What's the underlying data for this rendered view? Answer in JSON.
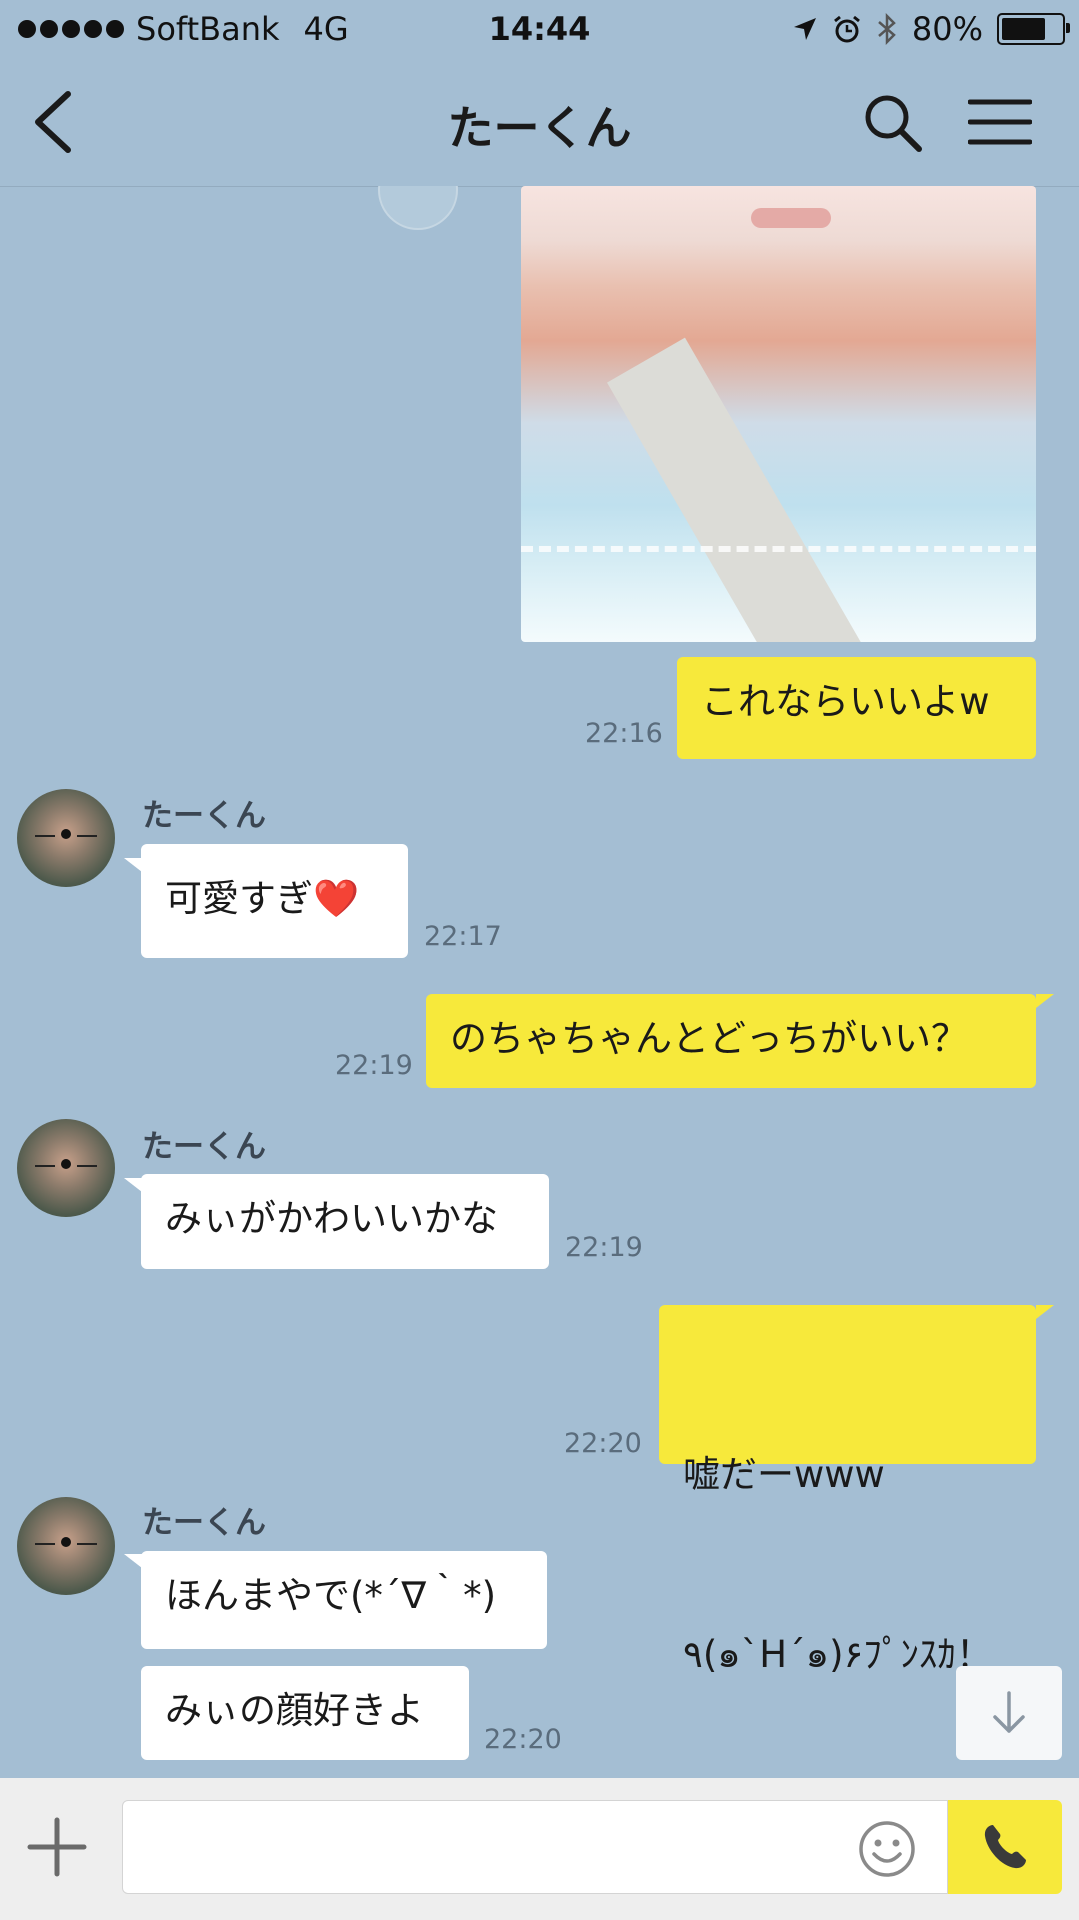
{
  "status_bar": {
    "carrier": "SoftBank",
    "network": "4G",
    "time": "14:44",
    "battery_text": "80%",
    "battery_level": 0.8
  },
  "header": {
    "title": "たーくん"
  },
  "messages": [
    {
      "side": "me",
      "type": "image"
    },
    {
      "side": "me",
      "text": "これならいいよw",
      "time": "22:16"
    },
    {
      "side": "them",
      "sender": "たーくん",
      "text": "可愛すぎ❤️",
      "time": "22:17"
    },
    {
      "side": "me",
      "text": "のちゃちゃんとどっちがいい？",
      "time": "22:19"
    },
    {
      "side": "them",
      "sender": "たーくん",
      "text": "みぃがかわいいかな",
      "time": "22:19"
    },
    {
      "side": "me",
      "text_line1": "嘘だーwww",
      "text_line2": "٩(๑`H´๑)۶ﾌﾟﾝｽｶ！",
      "time": "22:20"
    },
    {
      "side": "them",
      "sender": "たーくん",
      "text": "ほんまやで(*´∇｀*)"
    },
    {
      "side": "them",
      "text": "みぃの顔好きよ",
      "time": "22:20"
    }
  ],
  "icons": {
    "back": "chevron-left-icon",
    "search": "search-icon",
    "menu": "hamburger-menu-icon",
    "add": "plus-icon",
    "emoji": "smiley-icon",
    "call": "phone-icon",
    "scroll": "arrow-down-icon"
  },
  "colors": {
    "background": "#a4bed3",
    "my_bubble": "#f7e93b",
    "their_bubble": "#ffffff"
  }
}
